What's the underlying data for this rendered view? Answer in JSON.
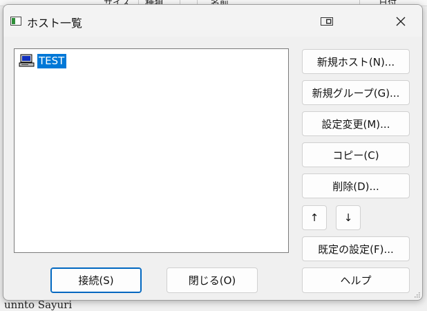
{
  "background": {
    "columns": [
      "サイズ",
      "種類",
      "名前",
      "日付"
    ],
    "bottom_text": "unnto Sayuri"
  },
  "dialog": {
    "title": "ホスト一覧",
    "hosts": [
      {
        "label": "TEST",
        "selected": true
      }
    ],
    "buttons": {
      "new_host": "新規ホスト(N)...",
      "new_group": "新規グループ(G)...",
      "change_settings": "設定変更(M)...",
      "copy": "コピー(C)",
      "delete": "削除(D)...",
      "move_up": "↑",
      "move_down": "↓",
      "default_settings": "既定の設定(F)...",
      "connect": "接続(S)",
      "close": "閉じる(O)",
      "help": "ヘルプ"
    }
  },
  "colors": {
    "selection": "#0078d7",
    "default_button_border": "#0067c0"
  }
}
